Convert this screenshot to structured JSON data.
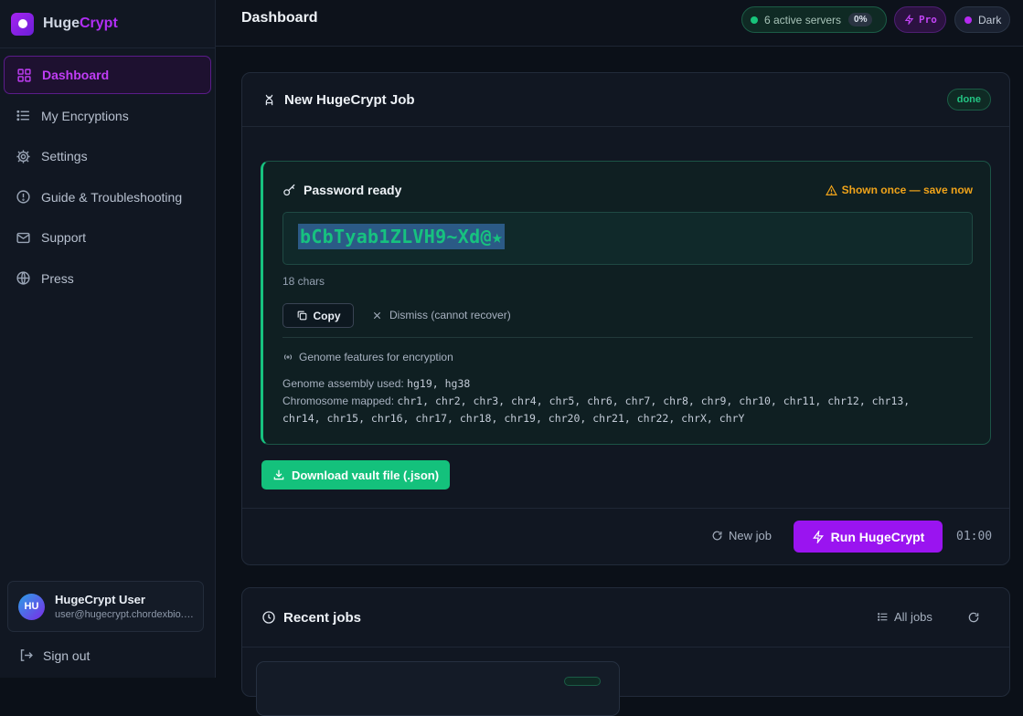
{
  "brand": {
    "name_a": "Huge",
    "name_b": "Crypt"
  },
  "sidebar": {
    "items": [
      {
        "label": "Dashboard",
        "icon": "grid-icon",
        "active": true
      },
      {
        "label": "My Encryptions",
        "icon": "list-icon"
      },
      {
        "label": "Settings",
        "icon": "gear-icon"
      },
      {
        "label": "Guide & Troubleshooting",
        "icon": "alert-circle-icon"
      },
      {
        "label": "Support",
        "icon": "mail-icon"
      },
      {
        "label": "Press",
        "icon": "globe-icon"
      }
    ],
    "user": {
      "initials": "HU",
      "name": "HugeCrypt User",
      "email": "user@hugecrypt.chordexbio.com"
    },
    "signout": "Sign out"
  },
  "header": {
    "title": "Dashboard",
    "servers": "6 active servers",
    "servers_load": "0%",
    "plan": "Pro",
    "theme": "Dark"
  },
  "job": {
    "title": "New HugeCrypt Job",
    "status": "done",
    "result": {
      "heading": "Password ready",
      "warning": "Shown once — save now",
      "password": "bCbTyab1ZLVH9~Xd@★",
      "length": "18 chars",
      "copy": "Copy",
      "dismiss": "Dismiss (cannot recover)",
      "features_title": "Genome features for encryption",
      "assembly_label": "Genome assembly used:",
      "assembly_value": "hg19, hg38",
      "chrom_label": "Chromosome mapped:",
      "chrom_value_1": "chr1, chr2, chr3, chr4, chr5, chr6, chr7, chr8, chr9, chr10, chr11, chr12, chr13,",
      "chrom_value_2": "chr14, chr15, chr16, chr17, chr18, chr19, chr20, chr21, chr22, chrX, chrY"
    },
    "download": "Download vault file (.json)",
    "new_job": "New job",
    "run": "Run HugeCrypt",
    "timer": "01:00"
  },
  "recent": {
    "title": "Recent jobs",
    "all": "All jobs"
  },
  "colors": {
    "accent": "#9a14f0",
    "success": "#14c17c",
    "warning": "#f0a31a"
  }
}
